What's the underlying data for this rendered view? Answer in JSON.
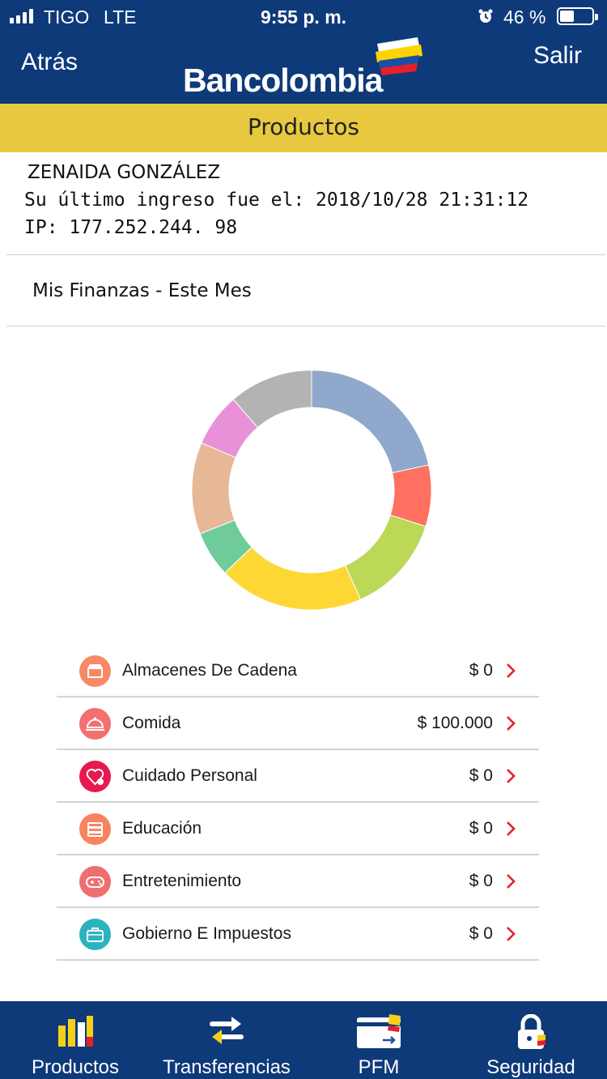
{
  "status_bar": {
    "carrier": "TIGO",
    "network": "LTE",
    "time": "9:55 p. m.",
    "battery_percent": "46 %",
    "battery_level": 0.46
  },
  "header": {
    "back_label": "Atrás",
    "brand": "Bancolombia",
    "exit_label": "Salir",
    "section_title": "Productos",
    "colors": {
      "navy": "#0e3a7a",
      "yellow": "#e8c83e"
    }
  },
  "user": {
    "name": "ZENAIDA GONZÁLEZ",
    "last_login": "Su último ingreso fue el: 2018/10/28 21:31:12",
    "ip": "IP: 177.252.244. 98"
  },
  "finanzas": {
    "title": "Mis Finanzas  - Este Mes"
  },
  "chart_data": {
    "type": "pie",
    "values": [
      21,
      8,
      13,
      19,
      6,
      12,
      7,
      11
    ],
    "colors": [
      "#8fa8cc",
      "#ff7060",
      "#bcd857",
      "#fdd835",
      "#6fcb9a",
      "#e6b896",
      "#e991d8",
      "#b3b3b3"
    ],
    "donut": true
  },
  "categories": [
    {
      "label": "Almacenes De Cadena",
      "value": "$ 0",
      "icon": "store-icon",
      "color": "#f78a66"
    },
    {
      "label": "Comida",
      "value": "$ 100.000",
      "icon": "food-cloche-icon",
      "color": "#f27070"
    },
    {
      "label": "Cuidado Personal",
      "value": "$ 0",
      "icon": "heart-care-icon",
      "color": "#e8194f"
    },
    {
      "label": "Educación",
      "value": "$ 0",
      "icon": "books-icon",
      "color": "#f7835f"
    },
    {
      "label": "Entretenimiento",
      "value": "$ 0",
      "icon": "gamepad-icon",
      "color": "#ef6f6f"
    },
    {
      "label": "Gobierno E Impuestos",
      "value": "$ 0",
      "icon": "briefcase-icon",
      "color": "#2bb3c0"
    }
  ],
  "tabbar": {
    "tabs": [
      {
        "label": "Productos",
        "icon": "products-bars-icon"
      },
      {
        "label": "Transferencias",
        "icon": "transfer-arrows-icon"
      },
      {
        "label": "PFM",
        "icon": "pfm-card-icon"
      },
      {
        "label": "Seguridad",
        "icon": "lock-icon"
      }
    ]
  }
}
